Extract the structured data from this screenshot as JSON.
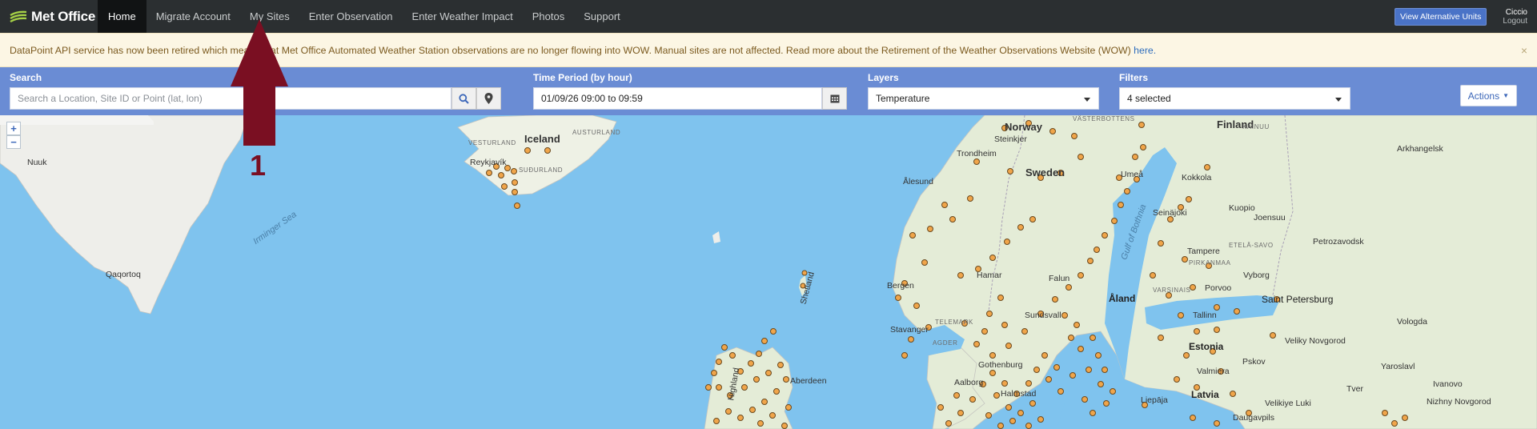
{
  "nav": {
    "logo_text": "Met Office",
    "items": [
      {
        "label": "Home",
        "active": true
      },
      {
        "label": "Migrate Account"
      },
      {
        "label": "My Sites"
      },
      {
        "label": "Enter Observation"
      },
      {
        "label": "Enter Weather Impact"
      },
      {
        "label": "Photos"
      },
      {
        "label": "Support"
      }
    ],
    "alt_units_label": "View Alternative Units",
    "user_name": "Ciccio",
    "logout_label": "Logout"
  },
  "banner": {
    "text": "DataPoint API service has now been retired which means that Met Office Automated Weather Station observations are no longer flowing into WOW. Manual sites are not affected. Read more about the Retirement of the Weather Observations Website (WOW) ",
    "link_text": "here.",
    "close": "×"
  },
  "toolbar": {
    "search_label": "Search",
    "search_placeholder": "Search a Location, Site ID or Point (lat, lon)",
    "time_label": "Time Period (by hour)",
    "time_value": "01/09/26 09:00 to 09:59",
    "layers_label": "Layers",
    "layers_value": "Temperature",
    "filters_label": "Filters",
    "filters_value": "4 selected",
    "actions_label": "Actions"
  },
  "map": {
    "zoom_in": "+",
    "zoom_out": "−",
    "labels": {
      "iceland": "Iceland",
      "austurland": "AUSTURLAND",
      "vesturland": "VESTURLAND",
      "reykjavik": "Reykjavík",
      "sudurland": "SUÐURLAND",
      "nuuk": "Nuuk",
      "qaqortoq": "Qaqortoq",
      "irminger": "Irminger Sea",
      "norway": "Norway",
      "sweden": "Sweden",
      "finland": "Finland",
      "steinkjer": "Steinkjer",
      "trondheim": "Trondheim",
      "alesund": "Ålesund",
      "bergen": "Bergen",
      "hamar": "Hamar",
      "falun": "Falun",
      "aland": "Åland",
      "stavanger": "Stavanger",
      "telemark": "TELEMARK",
      "agder": "AGDER",
      "gulf": "Gulf of Bothnia",
      "umea": "Umeå",
      "kokkola": "Kokkola",
      "kuopio": "Kuopio",
      "joensuu": "Joensuu",
      "tampere": "Tampere",
      "porvoo": "Porvoo",
      "vyborg": "Vyborg",
      "saint_petersburg": "Saint Petersburg",
      "petrozavodsk": "Petrozavodsk",
      "arkhangelsk": "Arkhangelsk",
      "vologda": "Vologda",
      "tallinn": "Tallinn",
      "estonia": "Estonia",
      "latvia": "Latvia",
      "liepaja": "Liepāja",
      "pskov": "Pskov",
      "veliky_novgorod": "Veliky Novgorod",
      "velikiye_luki": "Velikiye Luki",
      "tver": "Tver",
      "ivanovo": "Ivanovo",
      "yaroslavl": "Yaroslavl",
      "nizhny": "Nizhny Novgorod",
      "aalborg": "Aalborg",
      "gothenburg": "Gothenburg",
      "halmstad": "Halmstad",
      "sundsvall": "Sundsvall",
      "vasterbotten": "VÄSTERBOTTENS",
      "kainuu": "KAINUU",
      "seinajoki": "Seinäjoki",
      "etela_savo": "ETELÄ-SAVO",
      "pirkanmaa": "PIRKANMAA",
      "varsinais": "VARSINAIS",
      "shetland": "Shetland",
      "valmiera": "Valmiera",
      "daugavpils": "Daugavpils",
      "aberdeen": "Aberdeen",
      "highland": "Highland"
    }
  },
  "annotation": {
    "number": "1"
  }
}
